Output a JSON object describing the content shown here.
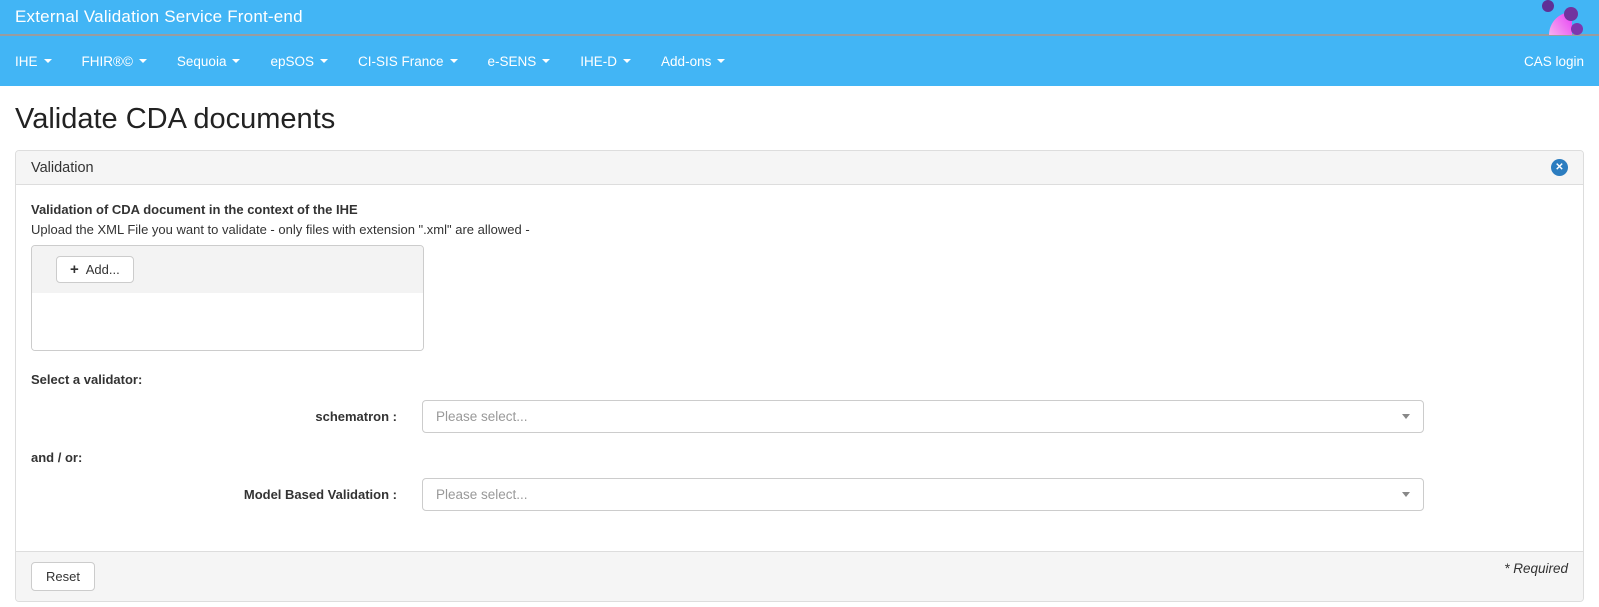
{
  "header": {
    "title": "External Validation Service Front-end"
  },
  "nav": {
    "items": [
      {
        "label": "IHE"
      },
      {
        "label": "FHIR®©"
      },
      {
        "label": "Sequoia"
      },
      {
        "label": "epSOS"
      },
      {
        "label": "CI-SIS France"
      },
      {
        "label": "e-SENS"
      },
      {
        "label": "IHE-D"
      },
      {
        "label": "Add-ons"
      }
    ],
    "cas_login_label": "CAS login"
  },
  "page": {
    "title": "Validate CDA documents"
  },
  "panel": {
    "title": "Validation",
    "body": {
      "heading": "Validation of CDA document in the context of the IHE",
      "subheading": "Upload the XML File you want to validate - only files with extension \".xml\" are allowed -",
      "upload": {
        "add_label": "Add..."
      },
      "select_validator_label": "Select a validator:",
      "and_or_label": "and / or:",
      "rows": [
        {
          "label": "schematron :",
          "placeholder": "Please select..."
        },
        {
          "label": "Model Based Validation :",
          "placeholder": "Please select..."
        }
      ]
    },
    "footer": {
      "reset_label": "Reset",
      "required_label": "* Required"
    }
  },
  "icons": {
    "close": "✕",
    "plus": "+",
    "caret_down": "caret-down-triangle",
    "logo": "gazelle-flower-logo"
  },
  "colors": {
    "navbar_blue": "#42b5f5",
    "panel_header_bg": "#f5f5f5",
    "panel_border": "#dddddd",
    "close_button_blue": "#2c7dc0",
    "placeholder_gray": "#999999",
    "logo_pink": "#ea4ff4",
    "logo_purple": "#71339f"
  }
}
